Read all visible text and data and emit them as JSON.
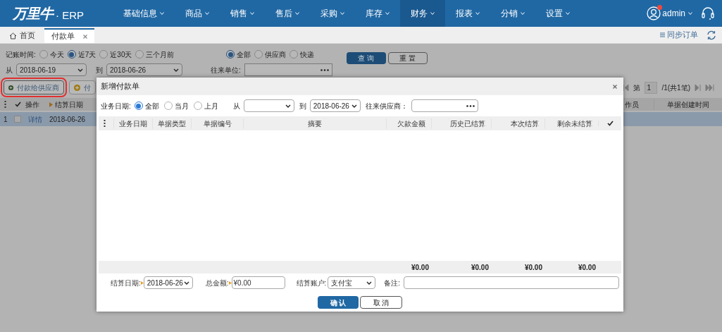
{
  "header": {
    "logo": "万里牛",
    "product": "· ERP",
    "menu": [
      {
        "label": "基础信息",
        "selected": false
      },
      {
        "label": "商品",
        "selected": false
      },
      {
        "label": "销售",
        "selected": false
      },
      {
        "label": "售后",
        "selected": false
      },
      {
        "label": "采购",
        "selected": false
      },
      {
        "label": "库存",
        "selected": false
      },
      {
        "label": "财务",
        "selected": true
      },
      {
        "label": "报表",
        "selected": false
      },
      {
        "label": "分销",
        "selected": false
      },
      {
        "label": "设置",
        "selected": false
      }
    ],
    "user": "admin",
    "notification": true
  },
  "tabs": [
    {
      "label": "首页",
      "kind": "home",
      "selected": false
    },
    {
      "label": "付款单",
      "kind": "closable",
      "selected": true
    }
  ],
  "sync_label": "同步订单",
  "filters": {
    "time_label": "记账时间:",
    "time_options": [
      {
        "label": "今天",
        "selected": false
      },
      {
        "label": "近7天",
        "selected": true
      },
      {
        "label": "近30天",
        "selected": false
      },
      {
        "label": "三个月前",
        "selected": false
      }
    ],
    "party_options": [
      {
        "label": "全部",
        "selected": true
      },
      {
        "label": "供应商",
        "selected": false
      },
      {
        "label": "快递",
        "selected": false
      }
    ],
    "query_button": "查 询",
    "reset_button": "重 置",
    "from_label": "从",
    "from_date": "2018-06-19",
    "to_label": "到",
    "to_date": "2018-06-26",
    "unit_label": "往来单位:"
  },
  "actions": [
    {
      "label": "付款给供应商",
      "highlighted": true
    },
    {
      "label": "付",
      "highlighted": false
    }
  ],
  "pager": {
    "page_label": "第",
    "page": "1",
    "total": "/1(共1笔)"
  },
  "table": {
    "columns": [
      "操作",
      "结算日期",
      "作员",
      "单据创建时间"
    ],
    "rows": [
      {
        "index": "1",
        "checked": false,
        "link": "详情",
        "date": "2018-06-26"
      }
    ]
  },
  "dialog": {
    "title": "新增付款单",
    "date_label": "业务日期:",
    "date_options": [
      {
        "label": "全部",
        "selected": true
      },
      {
        "label": "当月",
        "selected": false
      },
      {
        "label": "上月",
        "selected": false
      }
    ],
    "from_label": "从",
    "to_label": "到",
    "to_date": "2018-06-26",
    "supplier_label": "往来供应商：",
    "columns": [
      "业务日期",
      "单据类型",
      "单据编号",
      "摘要",
      "欠款金额",
      "历史已结算",
      "本次结算",
      "剩余未结算"
    ],
    "totals": [
      "¥0.00",
      "¥0.00",
      "¥0.00",
      "¥0.00"
    ],
    "settle_date_label": "结算日期:",
    "settle_date": "2018-06-26",
    "amount_label": "总金额:",
    "amount": "¥0.00",
    "account_label": "结算账户:",
    "account": "支付宝",
    "note_label": "备注:",
    "confirm_button": "确 认",
    "cancel_button": "取 消"
  }
}
